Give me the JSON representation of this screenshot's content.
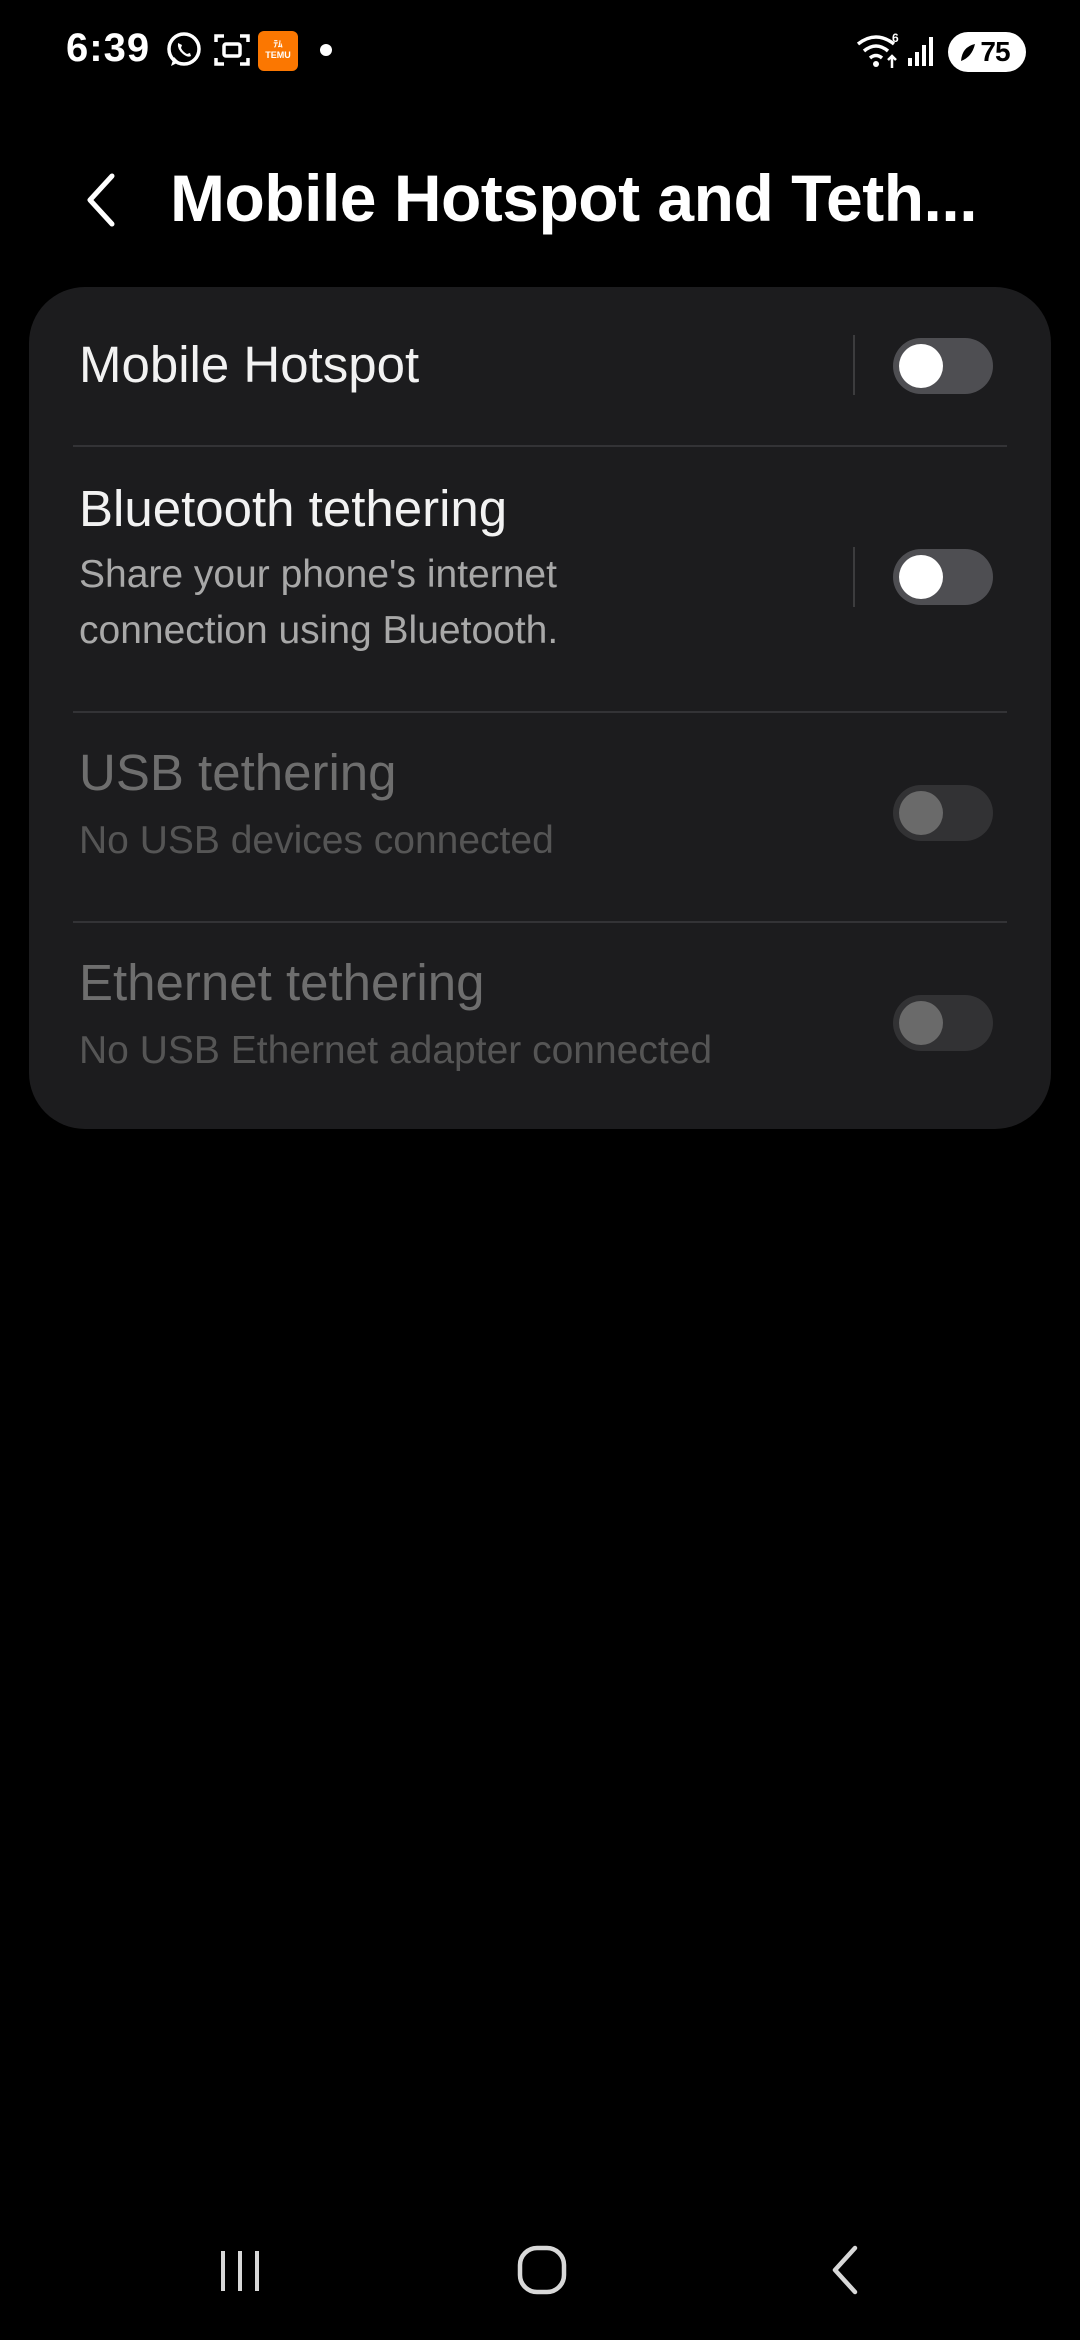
{
  "status_bar": {
    "time": "6:39",
    "notification_icons": [
      "whatsapp-icon",
      "screenshot-icon",
      "temu-icon",
      "dot-icon"
    ],
    "temu_badge_line1": "ﾃﾑ",
    "temu_badge_line2": "TEMU",
    "wifi_label": "6",
    "battery_level": "75"
  },
  "header": {
    "title": "Mobile Hotspot and Teth..."
  },
  "settings": {
    "items": [
      {
        "title": "Mobile Hotspot",
        "subtitle": "",
        "enabled": true,
        "checked": false
      },
      {
        "title": "Bluetooth tethering",
        "subtitle_line1": "Share your phone's internet",
        "subtitle_line2": "connection using Bluetooth.",
        "enabled": true,
        "checked": false
      },
      {
        "title": "USB tethering",
        "subtitle": "No USB devices connected",
        "enabled": false,
        "checked": false
      },
      {
        "title": "Ethernet tethering",
        "subtitle": "No USB Ethernet adapter connected",
        "enabled": false,
        "checked": false
      }
    ]
  },
  "colors": {
    "background": "#000000",
    "card": "#1c1c1e",
    "text_primary": "#f2f2f2",
    "text_secondary": "#a8a8a8",
    "text_disabled": "#6e6e6e",
    "temu_orange": "#fb7701"
  },
  "nav_bar": {
    "buttons": [
      "recent-apps-icon",
      "home-icon",
      "back-icon"
    ]
  }
}
